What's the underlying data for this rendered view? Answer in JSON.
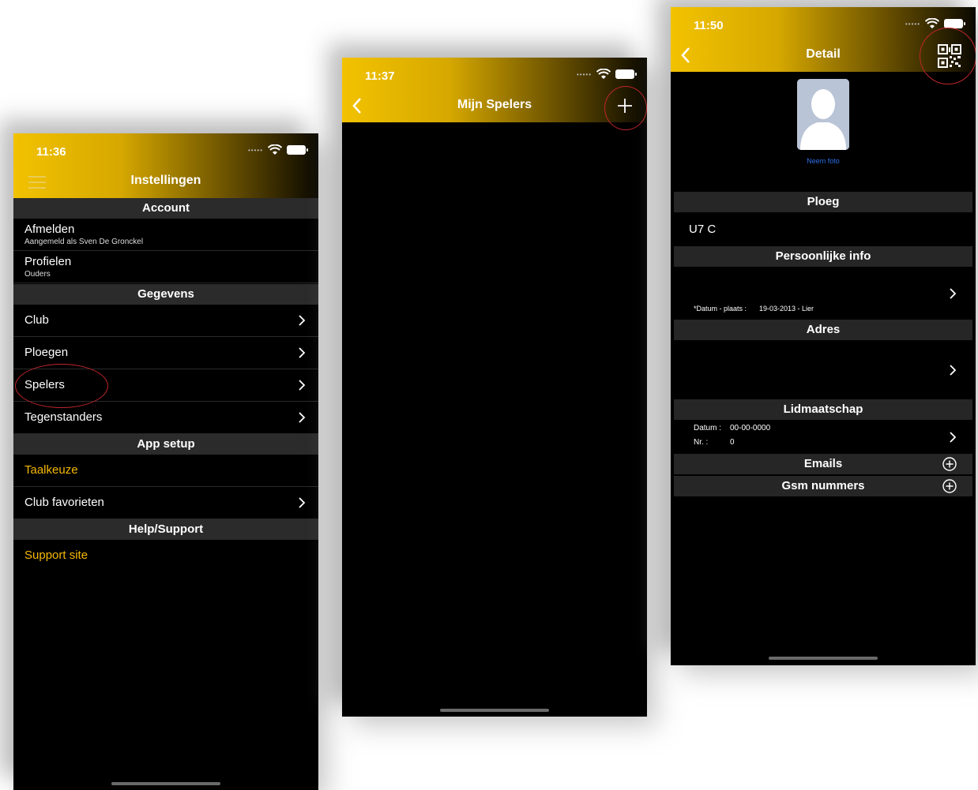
{
  "phone1": {
    "time": "11:36",
    "title": "Instellingen",
    "sections": {
      "account": "Account",
      "gegevens": "Gegevens",
      "app_setup": "App setup",
      "help": "Help/Support"
    },
    "rows": {
      "afmelden": "Afmelden",
      "afmelden_sub": "Aangemeld als Sven De Gronckel",
      "profielen": "Profielen",
      "profielen_sub": "Ouders",
      "club": "Club",
      "ploegen": "Ploegen",
      "spelers": "Spelers",
      "tegenstanders": "Tegenstanders",
      "taalkeuze": "Taalkeuze",
      "club_favorieten": "Club favorieten",
      "support_site": "Support site"
    }
  },
  "phone2": {
    "time": "11:37",
    "title": "Mijn Spelers"
  },
  "phone3": {
    "time": "11:50",
    "title": "Detail",
    "photo_link": "Neem foto",
    "sections": {
      "ploeg": "Ploeg",
      "persoonlijke_info": "Persoonlijke info",
      "adres": "Adres",
      "lidmaatschap": "Lidmaatschap",
      "emails": "Emails",
      "gsm": "Gsm nummers"
    },
    "ploeg_value": "U7 C",
    "datum_plaats_label": "*Datum - plaats :",
    "datum_plaats_value": "19-03-2013 - Lier",
    "datum_label": "Datum :",
    "datum_value": "00-00-0000",
    "nr_label": "Nr. :",
    "nr_value": "0"
  },
  "colors": {
    "accent": "#f5b800",
    "highlight_circle": "#c0262a"
  }
}
